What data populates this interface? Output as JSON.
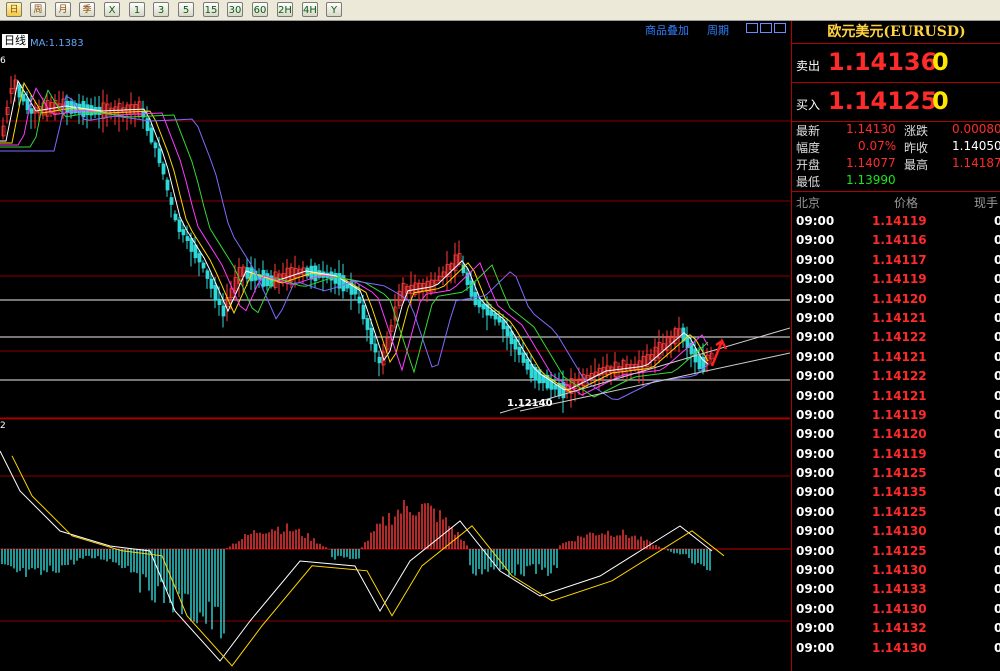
{
  "toolbar": {
    "buttons": [
      {
        "label": "日",
        "selected": true
      },
      {
        "label": "周"
      },
      {
        "label": "月"
      },
      {
        "label": "季"
      },
      {
        "label": "X"
      },
      {
        "label": "1"
      },
      {
        "label": "3"
      },
      {
        "label": "5"
      },
      {
        "label": "15"
      },
      {
        "label": "30"
      },
      {
        "label": "60"
      },
      {
        "label": "2H"
      },
      {
        "label": "4H"
      },
      {
        "label": "Y"
      }
    ]
  },
  "chart": {
    "links": {
      "add_product": "商品叠加",
      "cycle": "周期"
    },
    "period_label": "日线",
    "ma_label": "MA:1.1383",
    "corner_top": "6",
    "corner_bottom": "2",
    "low_label": "1.12140",
    "colors": {
      "bull": "#ff3b3b",
      "bear": "#2fd8d8",
      "ma1": "#ffffff",
      "ma2": "#ffd700",
      "ma3": "#ff3bff",
      "ma4": "#34d934",
      "ma5": "#7c6cff",
      "grid": "#8b0000"
    }
  },
  "quote": {
    "title": "欧元美元(EURUSD)",
    "sell_label": "卖出",
    "sell_main": "1.14136",
    "sell_tail": "0",
    "buy_label": "买入",
    "buy_main": "1.14125",
    "buy_tail": "0"
  },
  "stats": {
    "latest_label": "最新",
    "latest": "1.14130",
    "change_label": "涨跌",
    "change": "0.00080",
    "amp_label": "幅度",
    "amp": "0.07%",
    "prevclose_label": "昨收",
    "prevclose": "1.14050",
    "open_label": "开盘",
    "open": "1.14077",
    "high_label": "最高",
    "high": "1.14187",
    "low_label": "最低",
    "low": "1.13990"
  },
  "ticks": {
    "headers": {
      "time": "北京",
      "price": "价格",
      "volume": "现手"
    },
    "rows": [
      {
        "time": "09:00",
        "price": "1.14119",
        "vol": "0"
      },
      {
        "time": "09:00",
        "price": "1.14116",
        "vol": "0"
      },
      {
        "time": "09:00",
        "price": "1.14117",
        "vol": "0"
      },
      {
        "time": "09:00",
        "price": "1.14119",
        "vol": "0"
      },
      {
        "time": "09:00",
        "price": "1.14120",
        "vol": "0"
      },
      {
        "time": "09:00",
        "price": "1.14121",
        "vol": "0"
      },
      {
        "time": "09:00",
        "price": "1.14122",
        "vol": "0"
      },
      {
        "time": "09:00",
        "price": "1.14121",
        "vol": "0"
      },
      {
        "time": "09:00",
        "price": "1.14122",
        "vol": "0"
      },
      {
        "time": "09:00",
        "price": "1.14121",
        "vol": "0"
      },
      {
        "time": "09:00",
        "price": "1.14119",
        "vol": "0"
      },
      {
        "time": "09:00",
        "price": "1.14120",
        "vol": "0"
      },
      {
        "time": "09:00",
        "price": "1.14119",
        "vol": "0"
      },
      {
        "time": "09:00",
        "price": "1.14125",
        "vol": "0"
      },
      {
        "time": "09:00",
        "price": "1.14135",
        "vol": "0"
      },
      {
        "time": "09:00",
        "price": "1.14125",
        "vol": "0"
      },
      {
        "time": "09:00",
        "price": "1.14130",
        "vol": "0"
      },
      {
        "time": "09:00",
        "price": "1.14125",
        "vol": "0"
      },
      {
        "time": "09:00",
        "price": "1.14130",
        "vol": "0"
      },
      {
        "time": "09:00",
        "price": "1.14133",
        "vol": "0"
      },
      {
        "time": "09:00",
        "price": "1.14130",
        "vol": "0"
      },
      {
        "time": "09:00",
        "price": "1.14132",
        "vol": "0"
      },
      {
        "time": "09:00",
        "price": "1.14130",
        "vol": "0"
      }
    ]
  }
}
